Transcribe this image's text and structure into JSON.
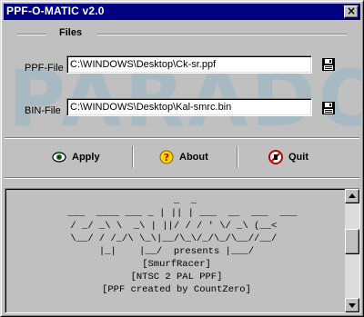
{
  "window": {
    "title": "PPF-O-MATIC v2.0",
    "close_glyph": "×"
  },
  "watermark": {
    "logo_text": "PARADOX",
    "color": "#9fb7c4"
  },
  "files": {
    "legend": "Files",
    "ppf": {
      "label": "PPF-File",
      "value": "C:\\WINDOWS\\Desktop\\Ck-sr.ppf",
      "icon": "floppy-disk-icon"
    },
    "bin": {
      "label": "BIN-File",
      "value": "C:\\WINDOWS\\Desktop\\Kal-smrc.bin",
      "icon": "floppy-disk-icon"
    }
  },
  "toolbar": {
    "apply_label": "Apply",
    "about_label": "About",
    "quit_label": "Quit",
    "apply_icon": "apply-eye-icon",
    "about_icon": "question-mark-icon",
    "quit_icon": "quit-stop-icon"
  },
  "info": {
    "ascii_logo": "                   _  _                \n  ___  ____ ___ _ | || | ___  __  ___  ___\n / _/ _\\ \\  _\\ | ||/ / / ' \\/ _\\ (__<  \n \\__/ / /_/\\ \\_\\|__/\\_\\/_/\\_/\\__//__/  ",
    "credit_line_1": "|_|    |__/  presents |___/",
    "credit_line_2": "[SmurfRacer]",
    "credit_line_3": "[NTSC 2 PAL PPF]",
    "credit_line_4": "[PPF created by CountZero]"
  },
  "colors": {
    "titlebar": "#000080",
    "face": "#c0c0c0"
  }
}
